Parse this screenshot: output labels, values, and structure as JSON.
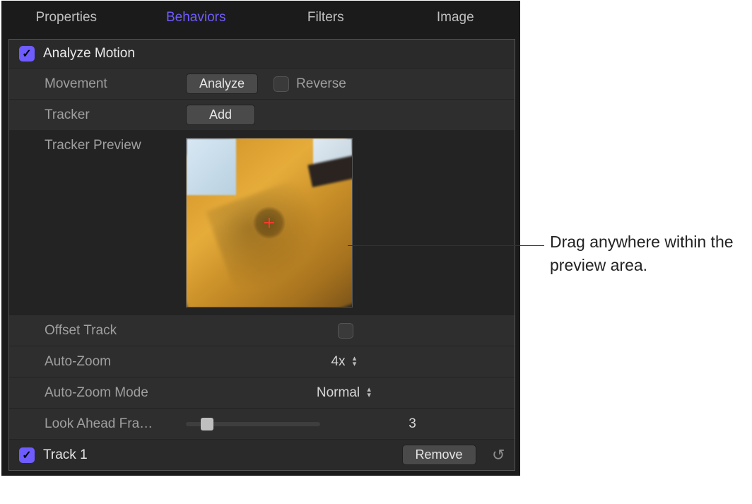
{
  "tabs": {
    "properties": "Properties",
    "behaviors": "Behaviors",
    "filters": "Filters",
    "image": "Image"
  },
  "section": {
    "title": "Analyze Motion",
    "enabled": true
  },
  "rows": {
    "movement": {
      "label": "Movement",
      "analyze_btn": "Analyze",
      "reverse_label": "Reverse",
      "reverse_checked": false
    },
    "tracker": {
      "label": "Tracker",
      "add_btn": "Add"
    },
    "tracker_preview": {
      "label": "Tracker Preview"
    },
    "offset_track": {
      "label": "Offset Track",
      "checked": false
    },
    "auto_zoom": {
      "label": "Auto-Zoom",
      "value": "4x"
    },
    "auto_zoom_mode": {
      "label": "Auto-Zoom Mode",
      "value": "Normal"
    },
    "look_ahead": {
      "label": "Look Ahead Fra…",
      "value": "3",
      "slider_pct": 11
    }
  },
  "footer": {
    "track_label": "Track 1",
    "track_enabled": true,
    "remove_btn": "Remove"
  },
  "callout": "Drag anywhere within the preview area."
}
